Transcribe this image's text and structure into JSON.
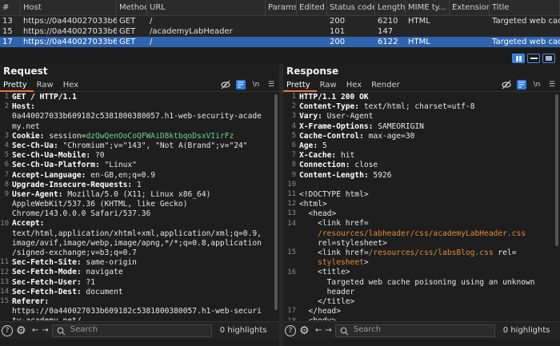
{
  "table": {
    "columns": [
      "#",
      "Host",
      "Method",
      "URL",
      "Params",
      "Edited",
      "Status code",
      "Length",
      "MIME ty...",
      "Extension",
      "Title"
    ],
    "rows": [
      [
        "13",
        "https://0a440027033b60...",
        "GET",
        "/",
        "",
        "",
        "200",
        "6210",
        "HTML",
        "",
        "Targeted web cache..."
      ],
      [
        "15",
        "https://0a440027033b60...",
        "GET",
        "/academyLabHeader",
        "",
        "",
        "101",
        "147",
        "",
        "",
        ""
      ],
      [
        "17",
        "https://0a440027033b60...",
        "GET",
        "/",
        "",
        "",
        "200",
        "6122",
        "HTML",
        "",
        "Targeted web cache ..."
      ]
    ],
    "selected_row": 2
  },
  "request": {
    "title": "Request",
    "tabs": [
      "Pretty",
      "Raw",
      "Hex"
    ],
    "lines": [
      {
        "n": "1",
        "k": "GET / HTTP/1.1",
        "v": ""
      },
      {
        "n": "2",
        "k": "Host:",
        "v": ""
      },
      {
        "n": "",
        "k": "",
        "v": "0a440027033b609182c5381800380057.h1-web-security-acade"
      },
      {
        "n": "",
        "k": "",
        "v": "my.net"
      },
      {
        "n": "3",
        "k": "Cookie: ",
        "v": "session=",
        "g": "dzQwQenOoCoQFWAiD8ktbqoDsxVIirFz"
      },
      {
        "n": "4",
        "k": "Sec-Ch-Ua: ",
        "v": "\"Chromium\";v=\"143\", \"Not A(Brand\";v=\"24\""
      },
      {
        "n": "5",
        "k": "Sec-Ch-Ua-Mobile: ",
        "v": "?0"
      },
      {
        "n": "6",
        "k": "Sec-Ch-Ua-Platform: ",
        "v": "\"Linux\""
      },
      {
        "n": "7",
        "k": "Accept-Language: ",
        "v": "en-GB,en;q=0.9"
      },
      {
        "n": "8",
        "k": "Upgrade-Insecure-Requests: ",
        "v": "1"
      },
      {
        "n": "9",
        "k": "User-Agent: ",
        "v": "Mozilla/5.0 (X11; Linux x86_64)"
      },
      {
        "n": "",
        "k": "",
        "v": "AppleWebKit/537.36 (KHTML, like Gecko)"
      },
      {
        "n": "",
        "k": "",
        "v": "Chrome/143.0.0.0 Safari/537.36"
      },
      {
        "n": "10",
        "k": "Accept:",
        "v": ""
      },
      {
        "n": "",
        "k": "",
        "v": "text/html,application/xhtml+xml,application/xml;q=0.9,"
      },
      {
        "n": "",
        "k": "",
        "v": "image/avif,image/webp,image/apng,*/*;q=0.8,application"
      },
      {
        "n": "",
        "k": "",
        "v": "/signed-exchange;v=b3;q=0.7"
      },
      {
        "n": "11",
        "k": "Sec-Fetch-Site: ",
        "v": "same-origin"
      },
      {
        "n": "12",
        "k": "Sec-Fetch-Mode: ",
        "v": "navigate"
      },
      {
        "n": "13",
        "k": "Sec-Fetch-User: ",
        "v": "?1"
      },
      {
        "n": "14",
        "k": "Sec-Fetch-Dest: ",
        "v": "document"
      },
      {
        "n": "15",
        "k": "Referer:",
        "v": ""
      },
      {
        "n": "",
        "k": "",
        "v": "https://0a440027033b609182c5381800380057.h1-web-securi"
      },
      {
        "n": "",
        "k": "",
        "v": "ty-academy.net/"
      }
    ],
    "search_placeholder": "Search",
    "highlights": "0 highlights"
  },
  "response": {
    "title": "Response",
    "tabs": [
      "Pretty",
      "Raw",
      "Hex",
      "Render"
    ],
    "lines": [
      {
        "n": "1",
        "k": "HTTP/1.1 200 OK",
        "v": ""
      },
      {
        "n": "2",
        "k": "Content-Type: ",
        "v": "text/html; charset=utf-8"
      },
      {
        "n": "3",
        "k": "Vary: ",
        "v": "User-Agent"
      },
      {
        "n": "4",
        "k": "X-Frame-Options: ",
        "v": "SAMEORIGIN"
      },
      {
        "n": "5",
        "k": "Cache-Control: ",
        "v": "max-age=30"
      },
      {
        "n": "6",
        "k": "Age: ",
        "v": "5"
      },
      {
        "n": "7",
        "k": "X-Cache: ",
        "v": "hit"
      },
      {
        "n": "8",
        "k": "Connection: ",
        "v": "close"
      },
      {
        "n": "9",
        "k": "Content-Length: ",
        "v": "5926"
      },
      {
        "n": "10",
        "k": "",
        "v": ""
      },
      {
        "n": "11",
        "k": "",
        "v": "<!DOCTYPE html>"
      },
      {
        "n": "12",
        "k": "",
        "v": "<html>"
      },
      {
        "n": "13",
        "k": "",
        "v": "  <head>"
      },
      {
        "n": "14",
        "k": "",
        "v": "    <link href=",
        "s": ""
      },
      {
        "n": "",
        "k": "",
        "v": "    ",
        "s": "/resources/labheader/css/academyLabHeader.css"
      },
      {
        "n": "",
        "k": "",
        "v": "    rel=stylesheet>"
      },
      {
        "n": "15",
        "k": "",
        "v": "    <link href=",
        "s": "/resources/css/labsBlog.css",
        "t": " rel="
      },
      {
        "n": "",
        "k": "",
        "v": "    ",
        "s": "stylesheet",
        "t": ">"
      },
      {
        "n": "16",
        "k": "",
        "v": "    <title>"
      },
      {
        "n": "",
        "k": "",
        "v": "      Targeted web cache poisoning using an unknown"
      },
      {
        "n": "",
        "k": "",
        "v": "      header"
      },
      {
        "n": "",
        "k": "",
        "v": "    </title>"
      },
      {
        "n": "17",
        "k": "",
        "v": "  </head>"
      },
      {
        "n": "18",
        "k": "",
        "v": "  <body>"
      }
    ],
    "search_placeholder": "Search",
    "highlights": "0 highlights"
  }
}
